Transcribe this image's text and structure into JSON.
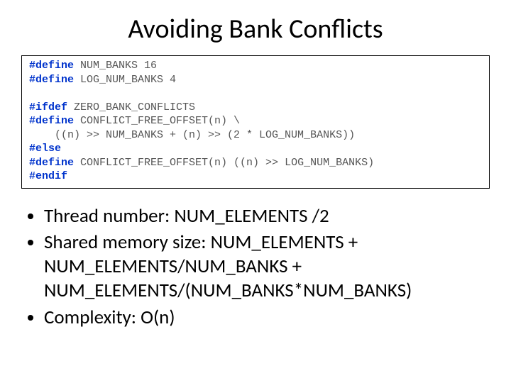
{
  "title": "Avoiding Bank Conflicts",
  "code": {
    "l1_kw": "#define",
    "l1_rest": " NUM_BANKS 16",
    "l2_kw": "#define",
    "l2_rest": " LOG_NUM_BANKS 4",
    "l3_kw": "#ifdef",
    "l3_rest": " ZERO_BANK_CONFLICTS",
    "l4_kw": "#define",
    "l4_rest": " CONFLICT_FREE_OFFSET(n) \\",
    "l5": "    ((n) >> NUM_BANKS + (n) >> (2 * LOG_NUM_BANKS))",
    "l6_kw": "#else",
    "l7_kw": "#define",
    "l7_rest": " CONFLICT_FREE_OFFSET(n) ((n) >> LOG_NUM_BANKS)",
    "l8_kw": "#endif"
  },
  "bullets": {
    "b1": "Thread number: NUM_ELEMENTS /2",
    "b2": "Shared memory size: NUM_ELEMENTS + NUM_ELEMENTS/NUM_BANKS + NUM_ELEMENTS/(NUM_BANKS*NUM_BANKS)",
    "b3": "Complexity: O(n)"
  }
}
